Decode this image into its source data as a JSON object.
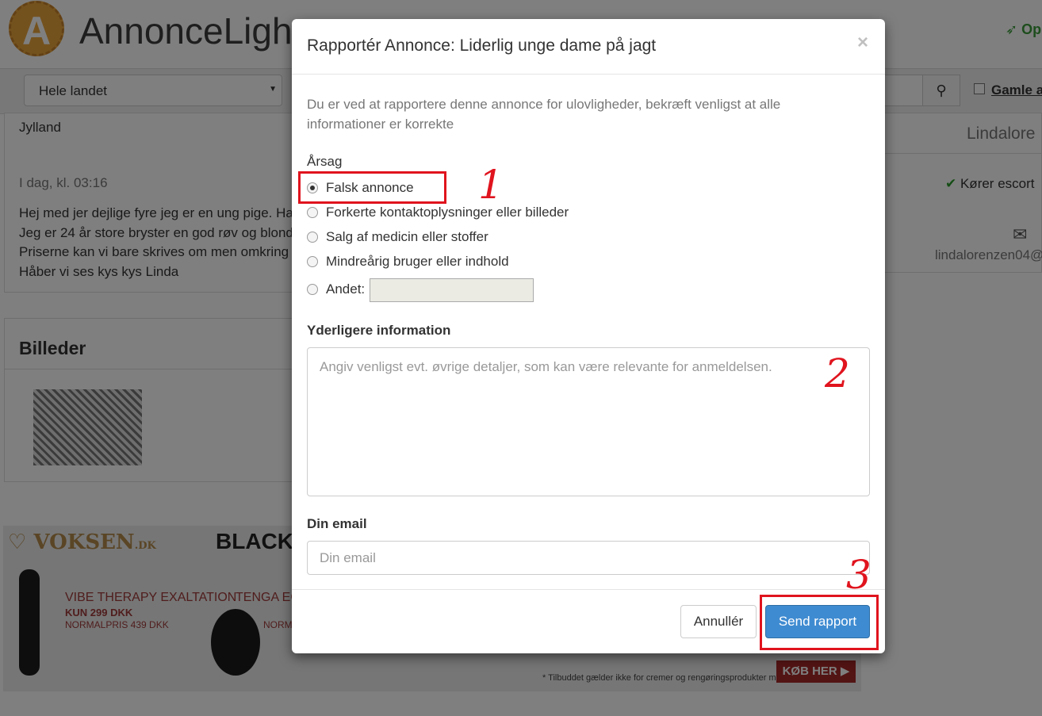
{
  "header": {
    "logo_letter": "A",
    "logo_text": "AnnonceLight",
    "create_link": "Op"
  },
  "search": {
    "region_value": "Hele landet",
    "old_ads_label": "Gamle a"
  },
  "listing": {
    "location": "Jylland",
    "date": "I dag, kl. 03:16",
    "body_lines": [
      "Hej med jer dejlige fyre jeg er en ung pige. Ha",
      "Jeg er 24 år store bryster en god røv og blond",
      "Priserne kan vi bare skrives om men omkring",
      "Håber vi ses kys kys Linda"
    ],
    "images_heading": "Billeder"
  },
  "sidebar": {
    "user_name": "Lindalore",
    "badge": "Kører escort",
    "email": "lindalorenzen04@"
  },
  "ad_banner": {
    "brand": "VOKSEN",
    "brand_suffix": ".DK",
    "headline": "BLACK FI",
    "product1_name": "VIBE THERAPY EXALTATION",
    "product1_price": "KUN 299 DKK",
    "product1_normal": "NORMALPRIS 439 DKK",
    "product2_name": "TENGA EGG",
    "product2_normal": "NORMA",
    "disclaimer": "* Tilbuddet gælder ikke for cremer og rengøringsprodukter mm.",
    "cta": "KØB HER ▶"
  },
  "modal": {
    "title": "Rapportér Annonce: Liderlig unge dame på jagt",
    "close": "×",
    "intro": "Du er ved at rapportere denne annonce for ulovligheder, bekræft venligst at alle informationer er korrekte",
    "reason_label": "Årsag",
    "reasons": [
      {
        "label": "Falsk annonce",
        "checked": true
      },
      {
        "label": "Forkerte kontaktoplysninger eller billeder",
        "checked": false
      },
      {
        "label": "Salg af medicin eller stoffer",
        "checked": false
      },
      {
        "label": "Mindreårig bruger eller indhold",
        "checked": false
      },
      {
        "label": "Andet:",
        "checked": false
      }
    ],
    "extra_label": "Yderligere information",
    "extra_placeholder": "Angiv venligst evt. øvrige detaljer, som kan være relevante for anmeldelsen.",
    "email_label": "Din email",
    "email_placeholder": "Din email",
    "cancel": "Annullér",
    "submit": "Send rapport"
  },
  "annotations": [
    "1",
    "2",
    "3"
  ]
}
